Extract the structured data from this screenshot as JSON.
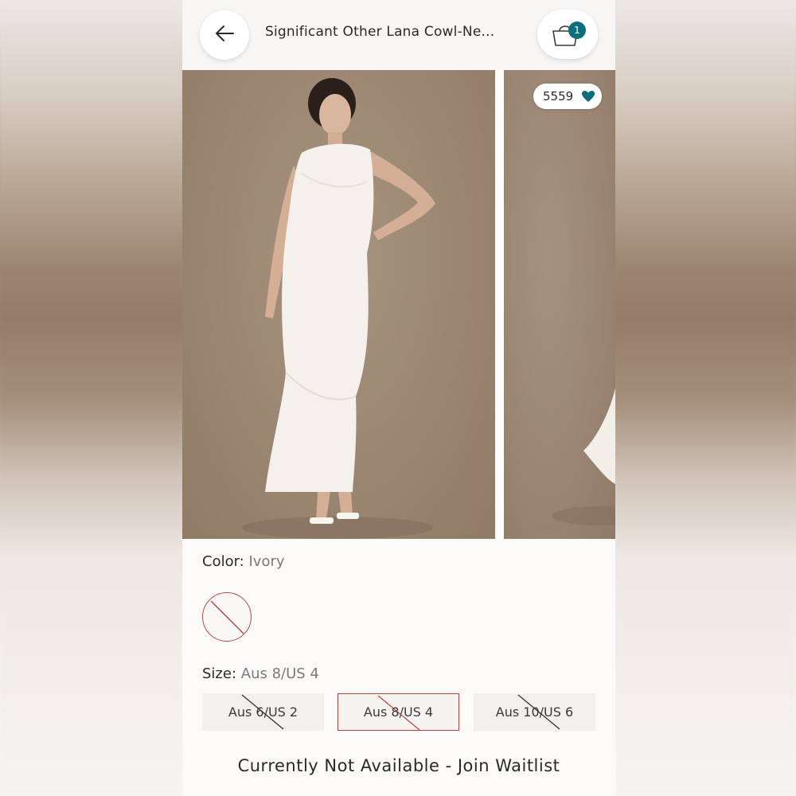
{
  "header": {
    "title": "Significant Other Lana Cowl-Ne...",
    "back_icon": "arrow-left-icon",
    "bag_icon": "shopping-bag-icon",
    "bag_count": "1",
    "bag_badge_color": "#0e6f7c"
  },
  "gallery": {
    "like_count": "5559",
    "like_icon": "heart-icon",
    "like_color": "#0e6f7c"
  },
  "color": {
    "label": "Color:",
    "value": "Ivory",
    "swatch_state": "unavailable"
  },
  "size": {
    "label": "Size:",
    "value": "Aus 8/US 4",
    "options": [
      {
        "label": "Aus 6/US 2",
        "available": false,
        "selected": false
      },
      {
        "label": "Aus 8/US 4",
        "available": false,
        "selected": true
      },
      {
        "label": "Aus 10/US 6",
        "available": false,
        "selected": false
      }
    ],
    "selected_border_color": "#b7413f"
  },
  "cta": {
    "label": "Currently Not Available - Join Waitlist"
  }
}
